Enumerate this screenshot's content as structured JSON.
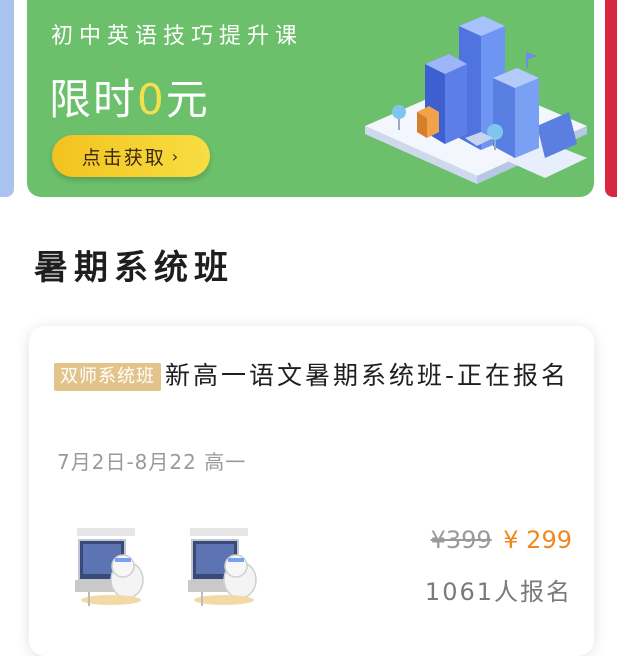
{
  "banner": {
    "subtitle": "初中英语技巧提升课",
    "title_prefix": "限时",
    "title_zero": "0",
    "title_suffix": "元",
    "cta_label": "点击获取"
  },
  "section": {
    "title": "暑期系统班"
  },
  "course": {
    "tag": "双师系统班",
    "title": "新高一语文暑期系统班-正在报名",
    "meta": "7月2日-8月22 高一",
    "price_original": "¥399",
    "price_current": "¥ 299",
    "enroll_count": "1061人报名"
  },
  "colors": {
    "banner_green": "#6cc06b",
    "accent_yellow": "#f6e04a",
    "tag_gold": "#e2c48a",
    "price_orange": "#f0891b"
  }
}
